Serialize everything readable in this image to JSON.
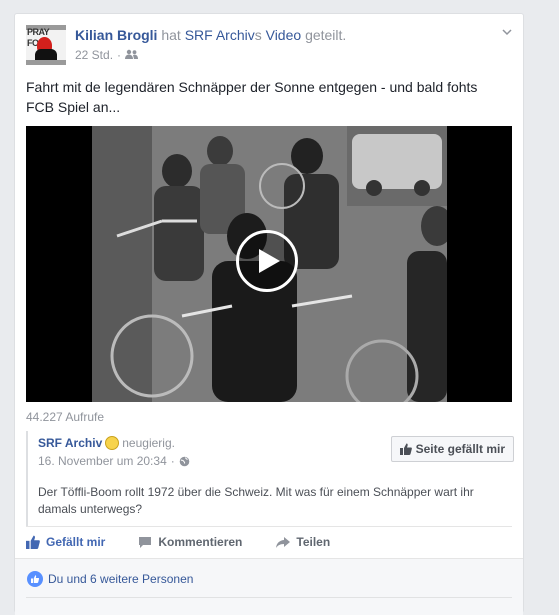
{
  "post": {
    "author": "Kilian Brogli",
    "shared_word": "hat",
    "shared_source": "SRF Archiv",
    "shared_source_suffix": "s",
    "shared_object": "Video",
    "shared_verb": "geteilt.",
    "time": "22 Std.",
    "separator": "·",
    "text": "Fahrt mit de legendären Schnäpper der Sonne entgegen - und bald fohts FCB Spiel an...",
    "avatar_text": "PRAY FOR JACK"
  },
  "video": {
    "views": "44.227 Aufrufe"
  },
  "shared_post": {
    "page_name": "SRF Archiv",
    "feeling": "neugierig.",
    "date": "16. November um 20:34",
    "separator": "·",
    "text": "Der Töffli-Boom rollt 1972 über die Schweiz. Mit was für einem Schnäpper wart ihr damals unterwegs?",
    "like_page_label": "Seite gefällt mir"
  },
  "actions": {
    "like": "Gefällt mir",
    "comment": "Kommentieren",
    "share": "Teilen"
  },
  "reactions": {
    "summary": "Du und 6 weitere Personen"
  },
  "colors": {
    "link": "#365899",
    "liked": "#4267b2",
    "muted": "#90949c"
  }
}
